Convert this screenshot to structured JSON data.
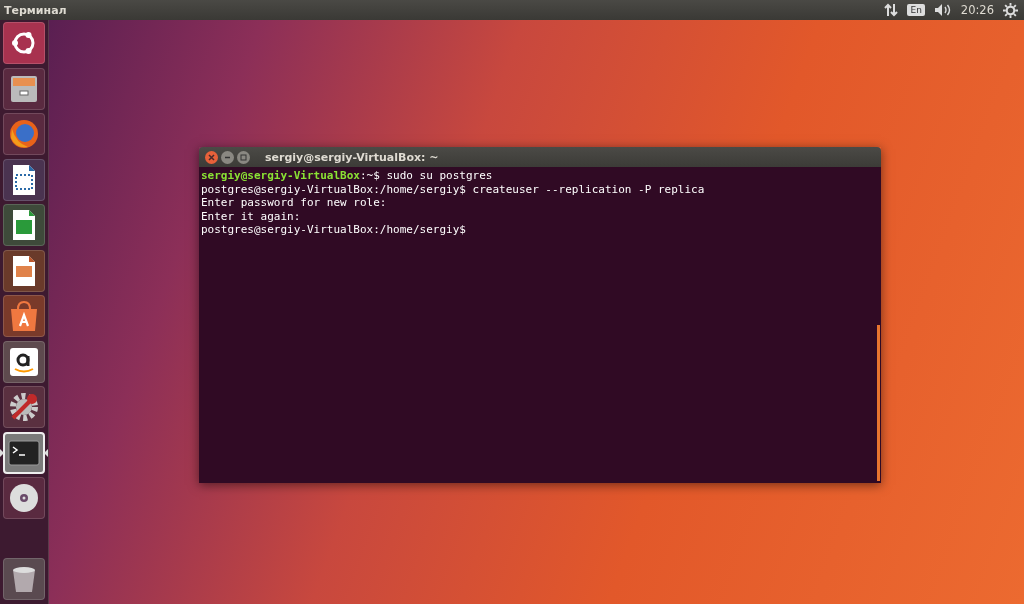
{
  "top_bar": {
    "title": "Терминал",
    "keyboard_layout": "En",
    "clock": "20:26"
  },
  "launcher": {
    "items": [
      {
        "kind": "ubuntu",
        "selected": false
      },
      {
        "kind": "files",
        "selected": false
      },
      {
        "kind": "browser",
        "selected": false
      },
      {
        "kind": "writer",
        "selected": false
      },
      {
        "kind": "calc",
        "selected": false
      },
      {
        "kind": "impress",
        "selected": false
      },
      {
        "kind": "store",
        "selected": false
      },
      {
        "kind": "amazon",
        "selected": false
      },
      {
        "kind": "settings",
        "selected": false
      },
      {
        "kind": "terminal",
        "selected": true
      },
      {
        "kind": "disc",
        "selected": false
      }
    ],
    "trash": {
      "kind": "trash",
      "selected": false
    }
  },
  "terminal": {
    "title": "sergiy@sergiy-VirtualBox: ~",
    "lines": [
      {
        "prompt": "sergiy@sergiy-VirtualBox",
        "text": ":~$ sudo su postgres"
      },
      {
        "text": "postgres@sergiy-VirtualBox:/home/sergiy$ createuser --replication -P replica"
      },
      {
        "text": "Enter password for new role:"
      },
      {
        "text": "Enter it again:"
      },
      {
        "text": "postgres@sergiy-VirtualBox:/home/sergiy$"
      }
    ]
  }
}
